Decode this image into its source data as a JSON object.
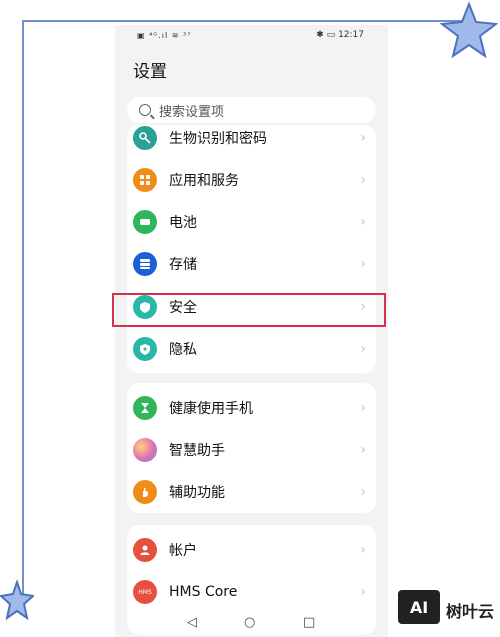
{
  "status_bar": {
    "left_text": "▣ ⁴ᴳ.ıl ≋ ³⁷",
    "time": "12:17",
    "right_icons": "✱ ▭"
  },
  "header": {
    "title": "设置"
  },
  "search": {
    "placeholder": "搜索设置项"
  },
  "groups": [
    {
      "items": [
        {
          "label": "生物识别和密码",
          "icon": "key-icon",
          "color": "#2aa198"
        },
        {
          "label": "应用和服务",
          "icon": "apps-grid-icon",
          "color": "#f08c1a"
        },
        {
          "label": "电池",
          "icon": "battery-icon",
          "color": "#2fb55b"
        },
        {
          "label": "存储",
          "icon": "storage-icon",
          "color": "#1f5fd6"
        },
        {
          "label": "安全",
          "icon": "shield-icon",
          "color": "#29b8a8",
          "highlighted": true
        },
        {
          "label": "隐私",
          "icon": "privacy-shield-icon",
          "color": "#29b8a8"
        }
      ]
    },
    {
      "items": [
        {
          "label": "健康使用手机",
          "icon": "hourglass-icon",
          "color": "#2fb55b"
        },
        {
          "label": "智慧助手",
          "icon": "assistant-orb-icon",
          "color": "#b86ad6"
        },
        {
          "label": "辅助功能",
          "icon": "hand-icon",
          "color": "#f08c1a"
        }
      ]
    },
    {
      "items": [
        {
          "label": "帐户",
          "icon": "user-icon",
          "color": "#e5503f"
        },
        {
          "label": "HMS Core",
          "icon": "hms-icon",
          "color": "#e5503f",
          "icon_text": "HMS"
        }
      ]
    }
  ],
  "navigation": {
    "back": "◁",
    "home": "○",
    "recent": "□"
  },
  "watermark": {
    "box_text": "AI",
    "text": "树叶云"
  }
}
